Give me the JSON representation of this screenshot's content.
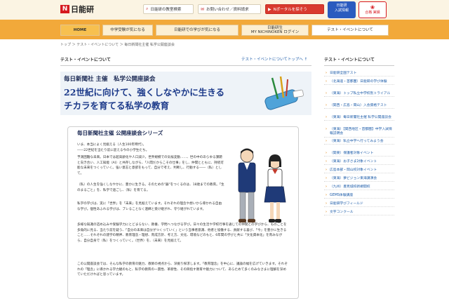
{
  "header": {
    "logo_mark": "N",
    "logo_text": "日能研",
    "links": [
      {
        "icon": "search-icon",
        "label": "日能研の教室検索"
      },
      {
        "icon": "mail-icon",
        "label": "お問い合わせ／資料請求"
      },
      {
        "icon": "arrow-icon",
        "label": "Nポータルを探そう"
      }
    ],
    "badge_blue": [
      "日能研",
      "入試情報"
    ],
    "badge_red": [
      "合格",
      "実績"
    ]
  },
  "nav": {
    "items": [
      {
        "label": "HOME"
      },
      {
        "label": "中学受験が気になる"
      },
      {
        "label": "日能研での学びが気になる"
      },
      {
        "label": "日能研生\nMY NICHINOKEN ログイン"
      },
      {
        "label": "テスト・イベントについて"
      }
    ]
  },
  "breadcrumb": {
    "items": [
      "トップ",
      "テスト・イベントについて",
      "毎日新聞社主催 私学公開座談会"
    ],
    "separator": "＞"
  },
  "main": {
    "title": "テスト・イベントについて",
    "to_top": "テスト・イベントについてトップへ ↑",
    "banner": {
      "sub": "毎日新聞社 主催　私学公開座談会",
      "line1": "22世紀に向けて、強くしなやかに生きる",
      "line2": "チカラを育てる私学の教育"
    },
    "series_title": "毎日新聞社主催 公開座談会シリーズ",
    "paragraphs": [
      "いま、本当によく見据える（人生100年時代）。",
      "――22世紀を当たり前に迎える今の小学生たち。",
      "予測困難な未来。日本では超高齢化や人口減少。世界規模での気候変動……、世の中のあらゆる課題と向き合い、人工知能（AI）と共存しながら、「人間だからこその仕事」をし、仲間とともに、持続可能な未来をつくっていく。強い意志と意欲をもって、自分で考え、判断し、行動する――（私）として。",
      "（私）の人生を強くしなやかに、豊かに生きる。そのための\"器\"をつくるのは、18歳までの教育。「生のまるごと」を、私学で過ごし、（私）を育てる。",
      "私学の学びは、実に「世界」を「未来」を見据えています。それぞれの理念や想いから導かれる自由な学び。個性あふれる学びは、ブレることなく連綿と受け継がれ、守り継がれています。",
      "多様な知識の詰め込みや受験学力にとどまらない、教養、学問へつながる学び。日々の生活や学校行事を通じての仲間との学びから、ものごとを多角的に見る、当たり前を疑う、「自分の未来は自分がつくっていく」という当事者意識、他者と協働する、貢献する喜び、「今」を豊かに生きること……それぞれの建学の精神、教育理念・理想、育成方針、考え方、文化、環境などのもと、6年間の学びと共に「文化資本化」を育みながら、自分自身で（私）をつくっていく。（世界）を、（未来）を見据えて。",
      "この公開座談会では、そんな私学の教育の魅力、教師の視点から、深掘り探求します。「教育理念」を中心に、議論の幅を広げていきます。それぞれの「理念」に導かれる学力観のもと、私学の教育の一貫性、革新性、その目指す教育や魅力について、あらためて多くのみなさまに理解を深めていただければと思っています。"
    ]
  },
  "sidebar": {
    "title": "テスト・イベントについて",
    "items": [
      "日能研全国テスト",
      "（北海道・首都圏）日能研の学び体験",
      "（東海）トップ私立中学校別トライアル",
      "（関西・広島・岡山）入会資格テスト",
      "（東海）毎日新聞社主催 私学公開座談会",
      "（東海）【関西地区・首都圏】中学入試情報説明会",
      "（東海）私立中学へ行ってみよう会",
      "（関東）保護者対象イベント",
      "（東海）お子さま対象イベント",
      "広島本部・岡山校対象イベント",
      "（東海）夢ビジョン東海講演会",
      "（九州）豊見城校新規開校",
      "GEMS体験講座",
      "日能研学びフィールド",
      "文字コンクール"
    ]
  }
}
